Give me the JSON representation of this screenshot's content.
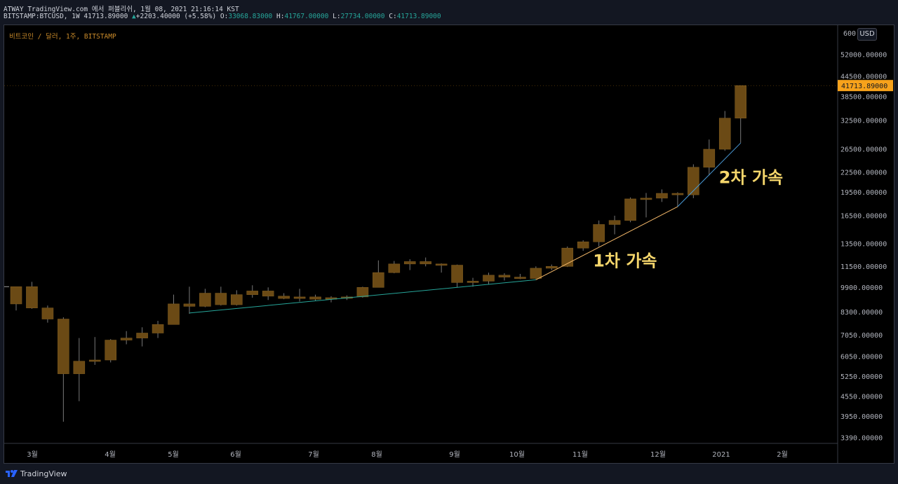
{
  "header": {
    "line1": "ATWAY TradingView.com 에서 퍼블리쉬, 1월 08, 2021 21:16:14 KST",
    "symbol": "BITSTAMP:BTCUSD, 1W 41713.89000",
    "change_arrow": "▲",
    "change": "+2203.40000 (+5.58%)",
    "o_label": "O:",
    "o_value": "33068.83000",
    "h_label": "H:",
    "h_value": "41767.00000",
    "l_label": "L:",
    "l_value": "27734.00000",
    "c_label": "C:",
    "c_value": "41713.89000"
  },
  "chart_subtitle": "비트코인 / 달러, 1주, BITSTAMP",
  "currency": "USD",
  "top_price_label": "600",
  "brand": "TradingView",
  "colors": {
    "background": "#000000",
    "candle": "#6b4a15",
    "wick": "#a0a0a0",
    "price_badge": "#f7a21b",
    "annotation": "#f5d66b",
    "trend1": "#26a69a",
    "trend2": "#f5b96a",
    "trend3": "#4a9bd8"
  },
  "chart_data": {
    "type": "candlestick",
    "scale": "log",
    "interval": "1W",
    "x_tick_labels": [
      "3월",
      "4월",
      "5월",
      "6월",
      "7월",
      "8월",
      "9월",
      "10월",
      "11월",
      "12월",
      "2021",
      "2월"
    ],
    "y_tick_labels": [
      52000,
      44500,
      38500,
      32500,
      26500,
      22500,
      19500,
      16500,
      13500,
      11500,
      9900,
      8300,
      7050,
      6050,
      5250,
      4550,
      3950,
      3390
    ],
    "ylim": [
      3200,
      61000
    ],
    "last_price": 41713.89,
    "last_price_label": "41713.89000",
    "candles": [
      {
        "o": 8800,
        "h": 9900,
        "l": 8400,
        "c": 9950
      },
      {
        "o": 9950,
        "h": 10300,
        "l": 8500,
        "c": 8550
      },
      {
        "o": 8550,
        "h": 8700,
        "l": 7700,
        "c": 7900
      },
      {
        "o": 7900,
        "h": 8000,
        "l": 3800,
        "c": 5350
      },
      {
        "o": 5350,
        "h": 6900,
        "l": 4400,
        "c": 5850
      },
      {
        "o": 5850,
        "h": 6950,
        "l": 5700,
        "c": 5900
      },
      {
        "o": 5900,
        "h": 6850,
        "l": 5800,
        "c": 6800
      },
      {
        "o": 6800,
        "h": 7250,
        "l": 6600,
        "c": 6900
      },
      {
        "o": 6900,
        "h": 7450,
        "l": 6500,
        "c": 7150
      },
      {
        "o": 7150,
        "h": 7800,
        "l": 6900,
        "c": 7600
      },
      {
        "o": 7600,
        "h": 9400,
        "l": 7600,
        "c": 8800
      },
      {
        "o": 8800,
        "h": 9950,
        "l": 8200,
        "c": 8650
      },
      {
        "o": 8650,
        "h": 9800,
        "l": 8600,
        "c": 9500
      },
      {
        "o": 9500,
        "h": 9950,
        "l": 8700,
        "c": 8750
      },
      {
        "o": 8750,
        "h": 9700,
        "l": 8700,
        "c": 9400
      },
      {
        "o": 9400,
        "h": 10050,
        "l": 9200,
        "c": 9650
      },
      {
        "o": 9650,
        "h": 9900,
        "l": 9050,
        "c": 9300
      },
      {
        "o": 9300,
        "h": 9500,
        "l": 9100,
        "c": 9150
      },
      {
        "o": 9150,
        "h": 9800,
        "l": 8950,
        "c": 9250
      },
      {
        "o": 9250,
        "h": 9400,
        "l": 9000,
        "c": 9100
      },
      {
        "o": 9100,
        "h": 9300,
        "l": 8900,
        "c": 9200
      },
      {
        "o": 9200,
        "h": 9350,
        "l": 9050,
        "c": 9250
      },
      {
        "o": 9250,
        "h": 9950,
        "l": 9200,
        "c": 9900
      },
      {
        "o": 9900,
        "h": 12000,
        "l": 9900,
        "c": 11000
      },
      {
        "o": 11000,
        "h": 11950,
        "l": 10950,
        "c": 11700
      },
      {
        "o": 11700,
        "h": 12100,
        "l": 11200,
        "c": 11900
      },
      {
        "o": 11900,
        "h": 12250,
        "l": 11500,
        "c": 11700
      },
      {
        "o": 11700,
        "h": 11750,
        "l": 11000,
        "c": 11600
      },
      {
        "o": 11600,
        "h": 11650,
        "l": 9900,
        "c": 10250
      },
      {
        "o": 10250,
        "h": 10600,
        "l": 9950,
        "c": 10350
      },
      {
        "o": 10350,
        "h": 11000,
        "l": 10100,
        "c": 10800
      },
      {
        "o": 10800,
        "h": 10950,
        "l": 10400,
        "c": 10650
      },
      {
        "o": 10650,
        "h": 10900,
        "l": 10500,
        "c": 10550
      },
      {
        "o": 10550,
        "h": 11500,
        "l": 10500,
        "c": 11350
      },
      {
        "o": 11350,
        "h": 11650,
        "l": 11200,
        "c": 11500
      },
      {
        "o": 11500,
        "h": 13250,
        "l": 11450,
        "c": 13100
      },
      {
        "o": 13100,
        "h": 13850,
        "l": 12850,
        "c": 13700
      },
      {
        "o": 13700,
        "h": 15950,
        "l": 13250,
        "c": 15500
      },
      {
        "o": 15500,
        "h": 16500,
        "l": 14450,
        "c": 15950
      },
      {
        "o": 15950,
        "h": 18800,
        "l": 15750,
        "c": 18600
      },
      {
        "o": 18600,
        "h": 19400,
        "l": 16300,
        "c": 18700
      },
      {
        "o": 18700,
        "h": 19900,
        "l": 18200,
        "c": 19350
      },
      {
        "o": 19350,
        "h": 19500,
        "l": 17600,
        "c": 19150
      },
      {
        "o": 19150,
        "h": 23800,
        "l": 18700,
        "c": 23300
      },
      {
        "o": 23300,
        "h": 28400,
        "l": 22000,
        "c": 26500
      },
      {
        "o": 26500,
        "h": 34800,
        "l": 26200,
        "c": 33068
      },
      {
        "o": 33068,
        "h": 41767,
        "l": 27734,
        "c": 41713
      }
    ],
    "trendlines": [
      {
        "from": {
          "candle": 11,
          "value": 8250
        },
        "to": {
          "candle": 33,
          "value": 10450
        }
      },
      {
        "from": {
          "candle": 33,
          "value": 10450
        },
        "to": {
          "candle": 42,
          "value": 17600
        }
      },
      {
        "from": {
          "candle": 42,
          "value": 17600
        },
        "to": {
          "candle": 46,
          "value": 27700
        }
      }
    ],
    "annotations": [
      {
        "text": "1차 가속",
        "anchor": {
          "candle": 36,
          "value": 11500
        }
      },
      {
        "text": "2차 가속",
        "anchor": {
          "candle": 44,
          "value": 20800
        }
      }
    ]
  }
}
